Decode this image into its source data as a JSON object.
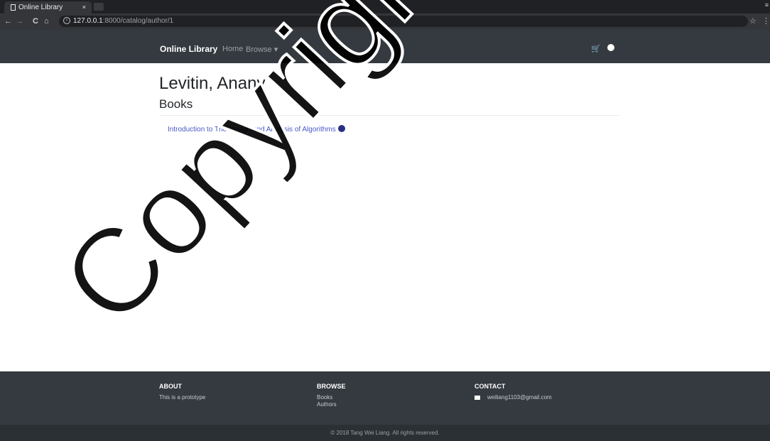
{
  "browser": {
    "tab_title": "Online Library",
    "tab_close": "×",
    "url_host": "127.0.0.1",
    "url_path": ":8000/catalog/author/1",
    "back_glyph": "←",
    "forward_glyph": "→",
    "reload_glyph": "C",
    "home_glyph": "⌂",
    "info_glyph": "i",
    "star_glyph": "☆",
    "menu_glyph": "⋮",
    "window_glyph": "≡"
  },
  "navbar": {
    "brand": "Online Library",
    "home": "Home",
    "browse": "Browse ▾",
    "cart_glyph": "🛒"
  },
  "main": {
    "author_name": "Levitin, Anany",
    "books_heading": "Books",
    "books": [
      {
        "title": "Introduction to The Design and Analysis of Algorithms"
      }
    ]
  },
  "footer": {
    "about_heading": "ABOUT",
    "about_text": "This is a prototype",
    "browse_heading": "BROWSE",
    "browse_links": [
      "Books",
      "Authors"
    ],
    "contact_heading": "CONTACT",
    "contact_email": "weiliang1103@gmail.com",
    "copyright": "© 2018 Tang Wei Liang. All rights reserved."
  },
  "watermark": "Copyright@",
  "colors": {
    "navbar_bg": "#343a40",
    "link": "#4a58c9",
    "footer_bg": "#343a40"
  }
}
